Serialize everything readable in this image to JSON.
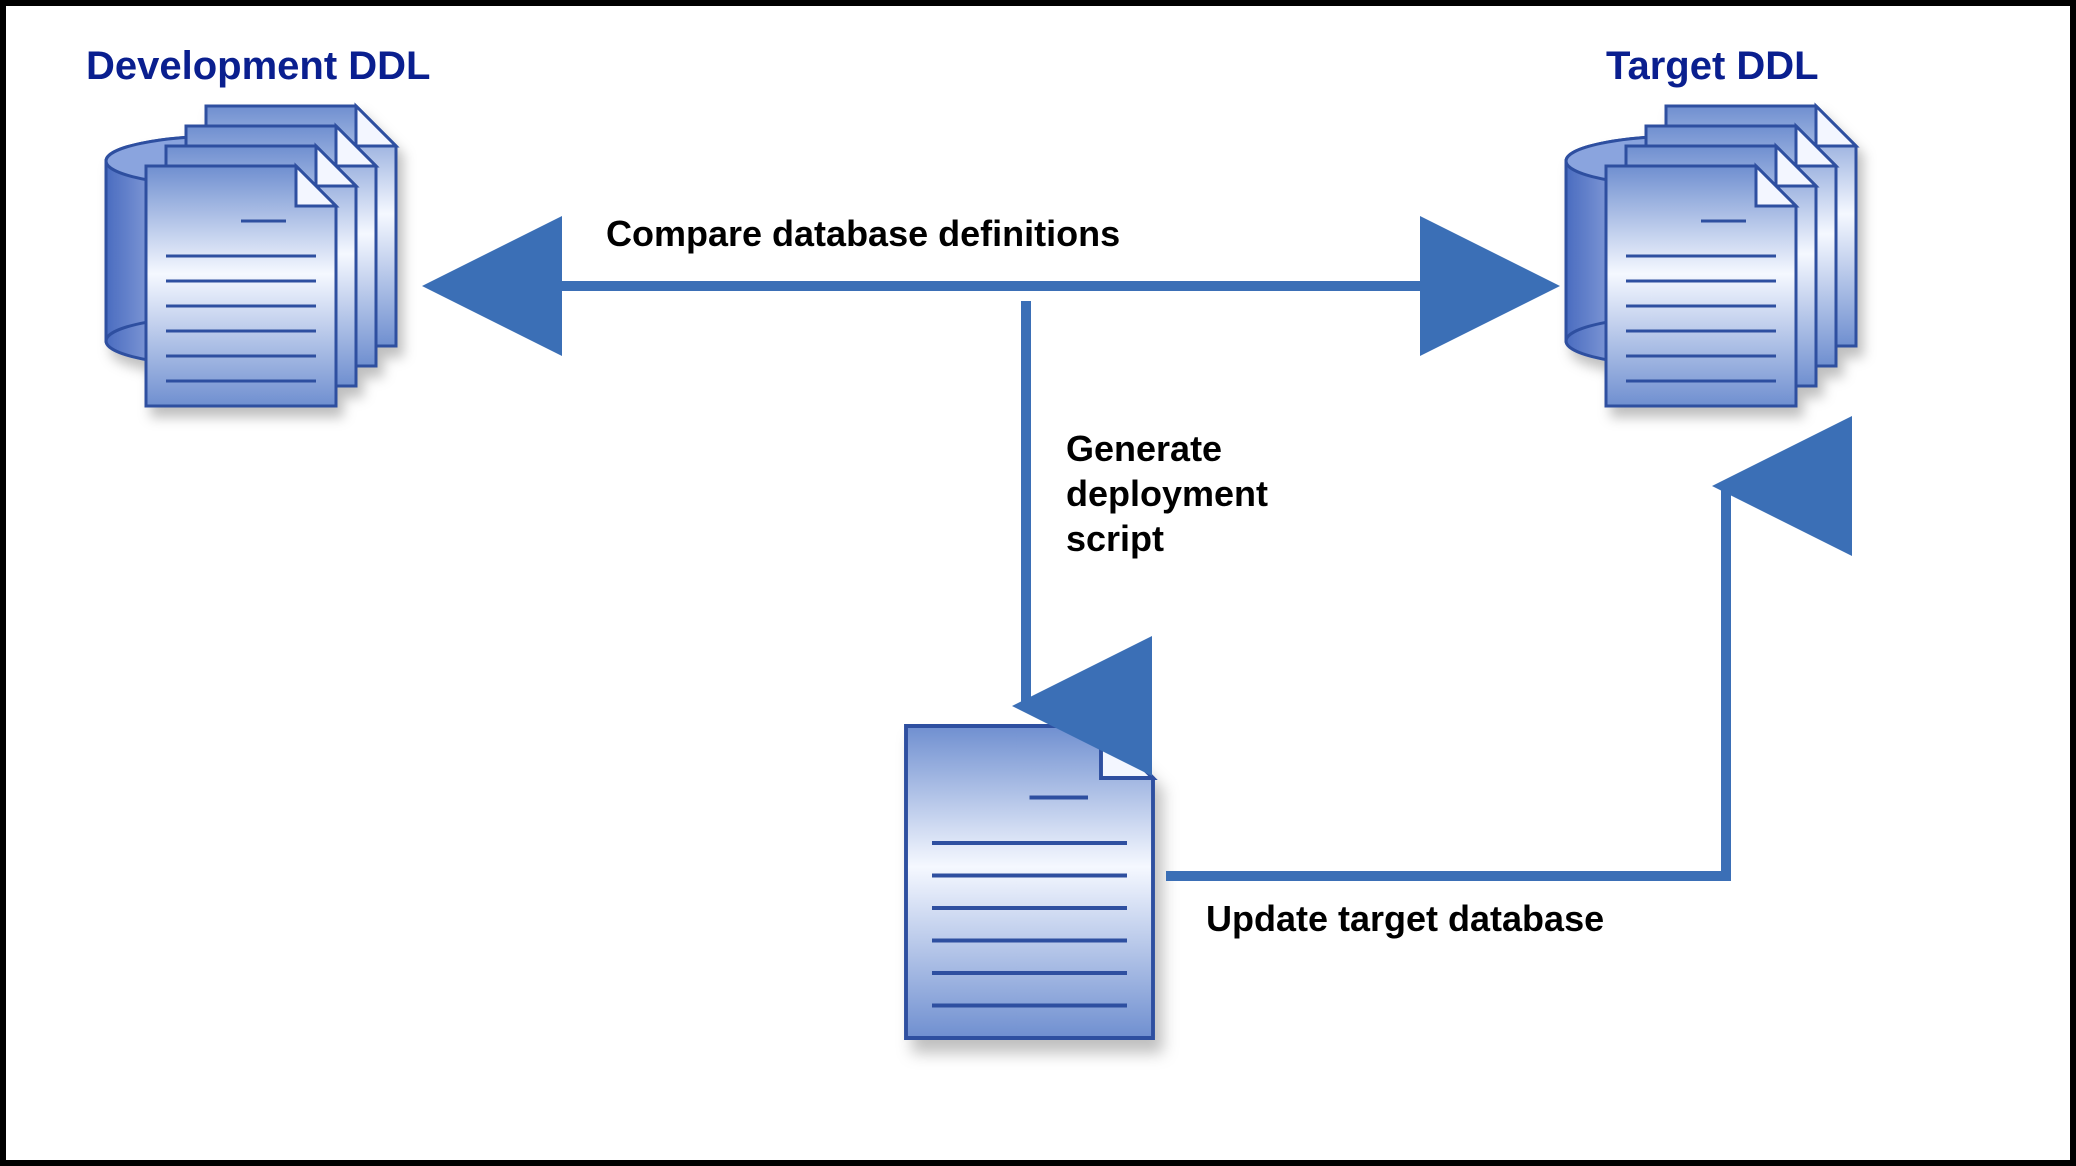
{
  "nodes": {
    "left": {
      "title": "Development DDL"
    },
    "right": {
      "title": "Target DDL"
    },
    "script": {
      "title": ""
    }
  },
  "steps": {
    "compare": "Compare database definitions",
    "generate": "Generate\ndeployment\nscript",
    "update": "Update target database"
  },
  "colors": {
    "title": "#0a1f8f",
    "arrow": "#3b6fb6",
    "docFill": "#8aa9dd",
    "docEdge": "#2e4fa0"
  }
}
